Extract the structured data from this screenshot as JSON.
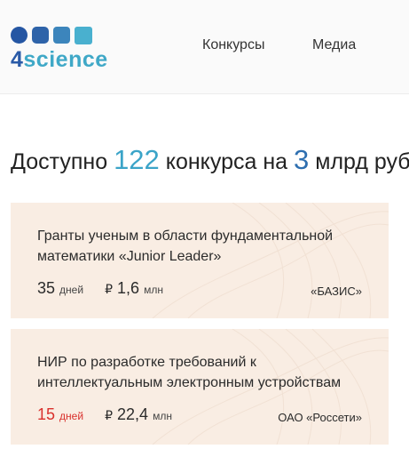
{
  "brand": {
    "digit": "4",
    "word": "science",
    "colors": [
      "#2556a3",
      "#2e63a9",
      "#3c85bc",
      "#49b0cf"
    ]
  },
  "nav": {
    "items": [
      {
        "label": "Конкурсы"
      },
      {
        "label": "Медиа"
      }
    ]
  },
  "headline": {
    "prefix": "Доступно",
    "count": "122",
    "middle": "конкурса на",
    "amount": "3",
    "suffix": "млрд руб."
  },
  "cards": [
    {
      "title": "Гранты ученым в области фундаментальной математики «Junior Leader»",
      "days": "35",
      "days_unit": "дней",
      "currency": "₽",
      "sum": "1,6",
      "sum_unit": "млн",
      "org": "«БАЗИС»",
      "urgent": false
    },
    {
      "title": "НИР по разработке требований к интеллектуальным электронным устройствам",
      "days": "15",
      "days_unit": "дней",
      "currency": "₽",
      "sum": "22,4",
      "sum_unit": "млн",
      "org": "ОАО «Россети»",
      "urgent": true
    }
  ],
  "colors": {
    "accent_light": "#3ba4c8",
    "accent_dark": "#2e6fb0",
    "card_bg": "#f9ede3",
    "urgent": "#d9302c"
  }
}
